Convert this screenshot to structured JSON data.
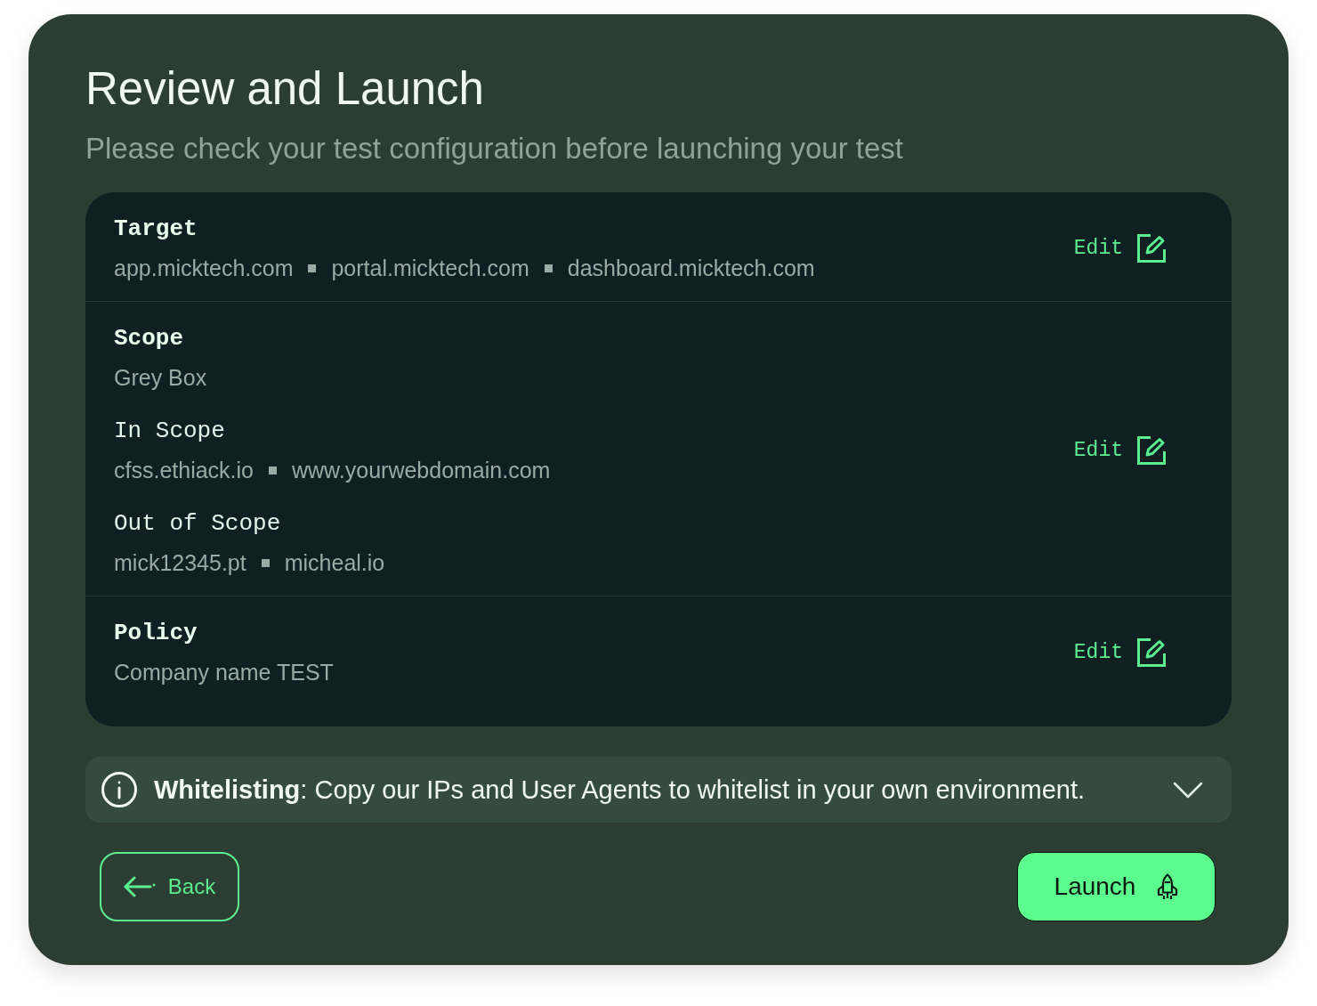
{
  "header": {
    "title": "Review and Launch",
    "subtitle": "Please check your test configuration before launching your test"
  },
  "sections": [
    {
      "heading": "Target",
      "groups": [
        {
          "values": [
            "app.micktech.com",
            "portal.micktech.com",
            "dashboard.micktech.com"
          ]
        }
      ],
      "action": "Edit"
    },
    {
      "heading": "Scope",
      "groups": [
        {
          "values": [
            "Grey Box"
          ]
        },
        {
          "label": "In Scope",
          "values": [
            "cfss.ethiack.io",
            "www.yourwebdomain.com"
          ]
        },
        {
          "label": "Out of Scope",
          "values": [
            "mick12345.pt",
            "micheal.io"
          ]
        }
      ],
      "action": "Edit"
    },
    {
      "heading": "Policy",
      "groups": [
        {
          "values": [
            "Company name TEST"
          ]
        }
      ],
      "action": "Edit"
    }
  ],
  "notice": {
    "text": "**Whitelisting**: Copy our IPs and User Agents to whitelist in your own environment.",
    "expanded": false
  },
  "buttons": [
    {
      "kind": "secondary",
      "label": "Back"
    },
    {
      "kind": "primary",
      "label": "Launch"
    }
  ]
}
